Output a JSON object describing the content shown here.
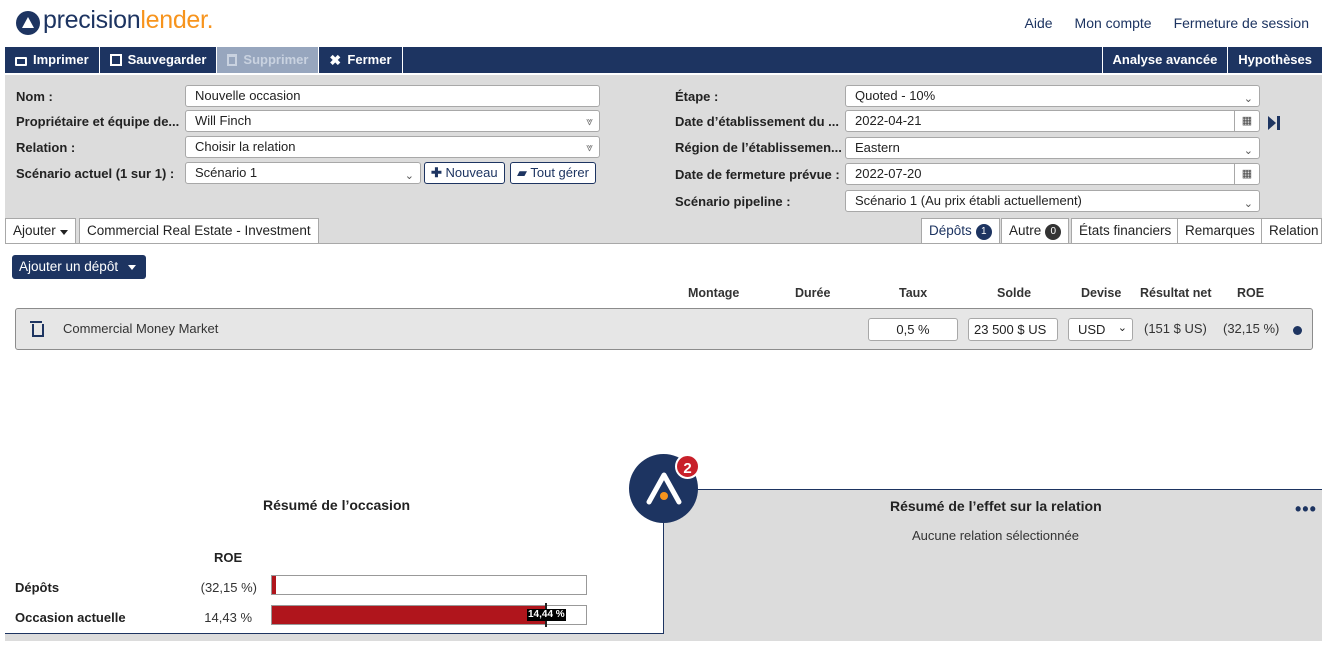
{
  "brand": {
    "part1": "precision",
    "part2": "lender."
  },
  "toplinks": {
    "help": "Aide",
    "account": "Mon compte",
    "logout": "Fermeture de session"
  },
  "toolbar": {
    "print": "Imprimer",
    "save": "Sauvegarder",
    "delete": "Supprimer",
    "close": "Fermer",
    "advanced": "Analyse avancée",
    "assumptions": "Hypothèses"
  },
  "form": {
    "name_label": "Nom :",
    "name_value": "Nouvelle occasion",
    "owner_label": "Propriétaire et équipe de...",
    "owner_value": "Will Finch",
    "relation_label": "Relation :",
    "relation_value": "Choisir la relation",
    "scenario_label": "Scénario actuel (1 sur 1) :",
    "scenario_value": "Scénario 1",
    "new_btn": "Nouveau",
    "manage_btn": "Tout gérer",
    "stage_label": "Étape :",
    "stage_value": "Quoted - 10%",
    "date_est_label": "Date d’établissement du ...",
    "date_est_value": "2022-04-21",
    "region_label": "Région de l’établissemen...",
    "region_value": "Eastern",
    "close_date_label": "Date de fermeture prévue :",
    "close_date_value": "2022-07-20",
    "pipeline_label": "Scénario pipeline :",
    "pipeline_value": "Scénario 1 (Au prix établi actuellement)"
  },
  "tabs_left": {
    "add": "Ajouter",
    "product": "Commercial Real Estate - Investment"
  },
  "tabs_right": {
    "deposits": "Dépôts",
    "deposits_count": "1",
    "other": "Autre",
    "other_count": "0",
    "financials": "États financiers",
    "notes": "Remarques",
    "relation": "Relation"
  },
  "add_deposit": "Ajouter un dépôt",
  "columns": {
    "montage": "Montage",
    "duree": "Durée",
    "taux": "Taux",
    "solde": "Solde",
    "devise": "Devise",
    "net": "Résultat net",
    "roe": "ROE"
  },
  "deposit_row": {
    "name": "Commercial Money Market",
    "rate": "0,5 %",
    "balance": "23 500 $ US",
    "currency": "USD",
    "net": "(151 $ US)",
    "roe": "(32,15 %)"
  },
  "summary": {
    "title": "Résumé de l’occasion",
    "roe_header": "ROE",
    "rows": [
      {
        "label": "Dépôts",
        "value": "(32,15 %)",
        "fill": 0.015
      },
      {
        "label": "Occasion actuelle",
        "value": "14,43 %",
        "fill": 0.87,
        "marker": "14,44 %"
      }
    ]
  },
  "relation_summary": {
    "title": "Résumé de l’effet sur la relation",
    "empty": "Aucune relation sélectionnée"
  },
  "notifications": "2",
  "colors": {
    "navy": "#1d3461",
    "orange": "#f7941d",
    "red": "#b0151c"
  }
}
